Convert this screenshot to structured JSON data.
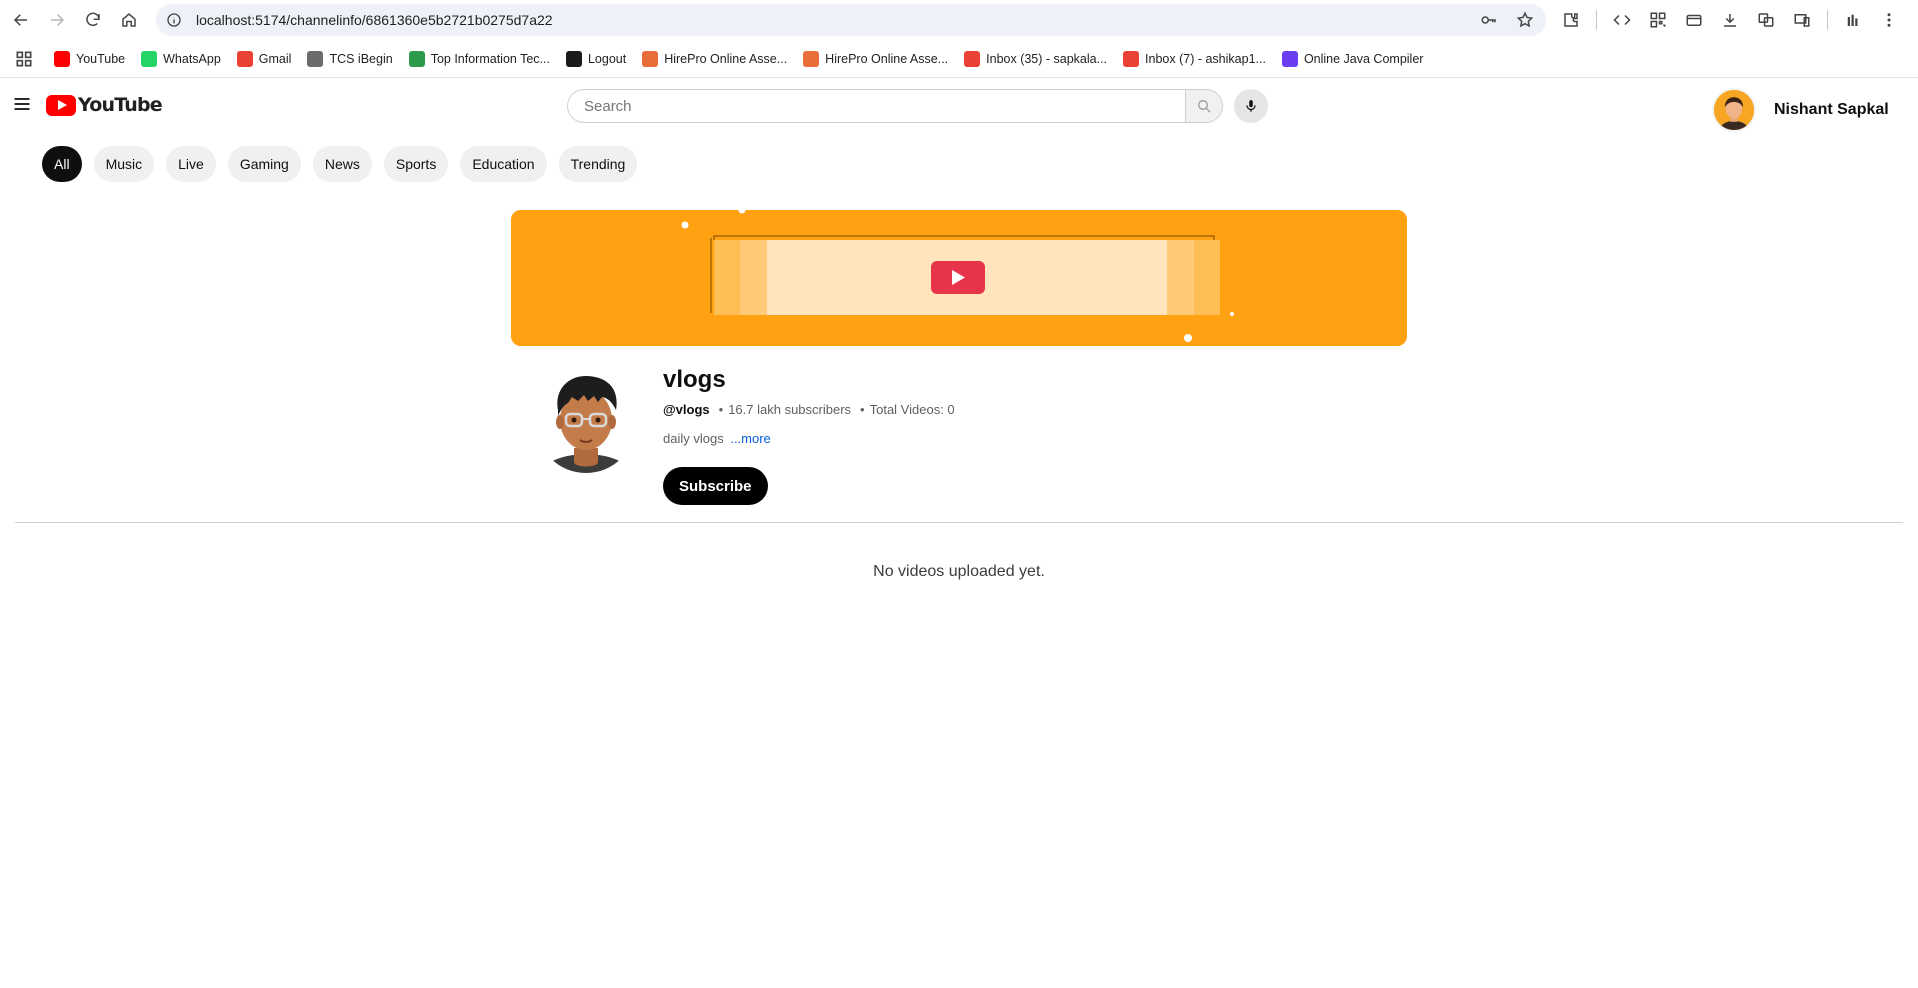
{
  "browser": {
    "url": "localhost:5174/channelinfo/6861360e5b2721b0275d7a22",
    "bookmarks": [
      {
        "label": "YouTube",
        "icon": "youtube-icon",
        "color": "#ff0000"
      },
      {
        "label": "WhatsApp",
        "icon": "whatsapp-icon",
        "color": "#25d366"
      },
      {
        "label": "Gmail",
        "icon": "gmail-icon",
        "color": "#ea4335"
      },
      {
        "label": "TCS iBegin",
        "icon": "tcs-icon",
        "color": "#6b6b6b"
      },
      {
        "label": "Top Information Tec...",
        "icon": "leaf-icon",
        "color": "#2e9b4c"
      },
      {
        "label": "Logout",
        "icon": "logout-icon",
        "color": "#1a1a1a"
      },
      {
        "label": "HirePro Online Asse...",
        "icon": "hirepro-icon",
        "color": "#e96d3a"
      },
      {
        "label": "HirePro Online Asse...",
        "icon": "hirepro-icon",
        "color": "#e96d3a"
      },
      {
        "label": "Inbox (35) - sapkala...",
        "icon": "gmail-icon",
        "color": "#ea4335"
      },
      {
        "label": "Inbox (7) - ashikap1...",
        "icon": "gmail-icon",
        "color": "#ea4335"
      },
      {
        "label": "Online Java Compiler",
        "icon": "compiler-icon",
        "color": "#6a3df0"
      }
    ]
  },
  "header": {
    "logo_text": "YouTube",
    "search_placeholder": "Search",
    "user_name": "Nishant Sapkal"
  },
  "chips": [
    "All",
    "Music",
    "Live",
    "Gaming",
    "News",
    "Sports",
    "Education",
    "Trending"
  ],
  "channel": {
    "name": "vlogs",
    "handle": "@vlogs",
    "subscribers": "16.7 lakh subscribers",
    "total_videos": "Total Videos: 0",
    "description": "daily vlogs",
    "more_label": "...more",
    "subscribe_label": "Subscribe"
  },
  "empty_message": "No videos uploaded yet.",
  "colors": {
    "banner": "#ffa111",
    "brand_red": "#ff0000",
    "link": "#065fd4"
  }
}
